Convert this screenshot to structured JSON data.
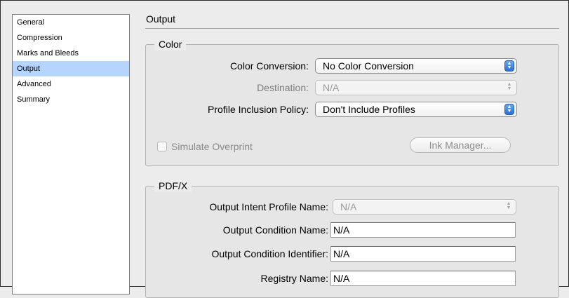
{
  "sidebar": {
    "items": [
      {
        "label": "General"
      },
      {
        "label": "Compression"
      },
      {
        "label": "Marks and Bleeds"
      },
      {
        "label": "Output",
        "selected": true
      },
      {
        "label": "Advanced"
      },
      {
        "label": "Summary"
      }
    ]
  },
  "header": {
    "title": "Output"
  },
  "color": {
    "group_title": "Color",
    "color_conversion": {
      "label": "Color Conversion:",
      "value": "No Color Conversion"
    },
    "destination": {
      "label": "Destination:",
      "value": "N/A"
    },
    "profile_inclusion": {
      "label": "Profile Inclusion Policy:",
      "value": "Don't Include Profiles"
    },
    "simulate_overprint": {
      "label": "Simulate Overprint",
      "checked": false
    },
    "ink_manager_label": "Ink Manager..."
  },
  "pdfx": {
    "group_title": "PDF/X",
    "output_intent_profile": {
      "label": "Output Intent Profile Name:",
      "value": "N/A"
    },
    "output_condition_name": {
      "label": "Output Condition Name:",
      "value": "N/A"
    },
    "output_condition_identifier": {
      "label": "Output Condition Identifier:",
      "value": "N/A"
    },
    "registry_name": {
      "label": "Registry Name:",
      "value": "N/A"
    }
  },
  "colors": {
    "selection": "#b5d5ff",
    "popup_accent": "#2a6fd6"
  }
}
